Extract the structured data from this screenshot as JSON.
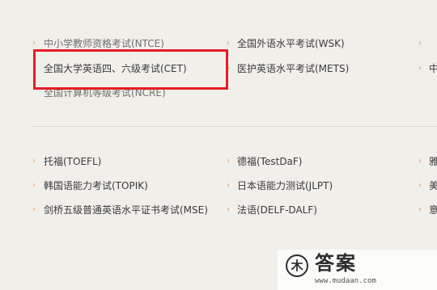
{
  "top_section": {
    "col1": [
      {
        "label": "中小学教师资格考试(NTCE)"
      },
      {
        "label": "全国大学英语四、六级考试(CET)"
      },
      {
        "label": "全国计算机等级考试(NCRE)"
      }
    ],
    "col2": [
      {
        "label": "全国外语水平考试(WSK)"
      },
      {
        "label": "医护英语水平考试(METS)"
      }
    ],
    "col3": [
      {
        "label": ""
      },
      {
        "label": "中"
      }
    ]
  },
  "bottom_section": {
    "col1": [
      {
        "label": "托福(TOEFL)"
      },
      {
        "label": "韩国语能力考试(TOPIK)"
      },
      {
        "label": "剑桥五级普通英语水平证书考试(MSE)"
      }
    ],
    "col2": [
      {
        "label": "德福(TestDaF)"
      },
      {
        "label": "日本语能力测试(JLPT)"
      },
      {
        "label": "法语(DELF-DALF)"
      }
    ],
    "col3": [
      {
        "label": "雅"
      },
      {
        "label": "美"
      },
      {
        "label": "意"
      }
    ]
  },
  "watermark": {
    "logo_glyph": "木",
    "title": "答案",
    "url": "www.mudaan.com"
  },
  "colors": {
    "highlight_border": "#e31e24",
    "arrow": "#e29a52",
    "background": "#f1efea"
  },
  "icons": {
    "bullet": "chevron-right-icon"
  }
}
